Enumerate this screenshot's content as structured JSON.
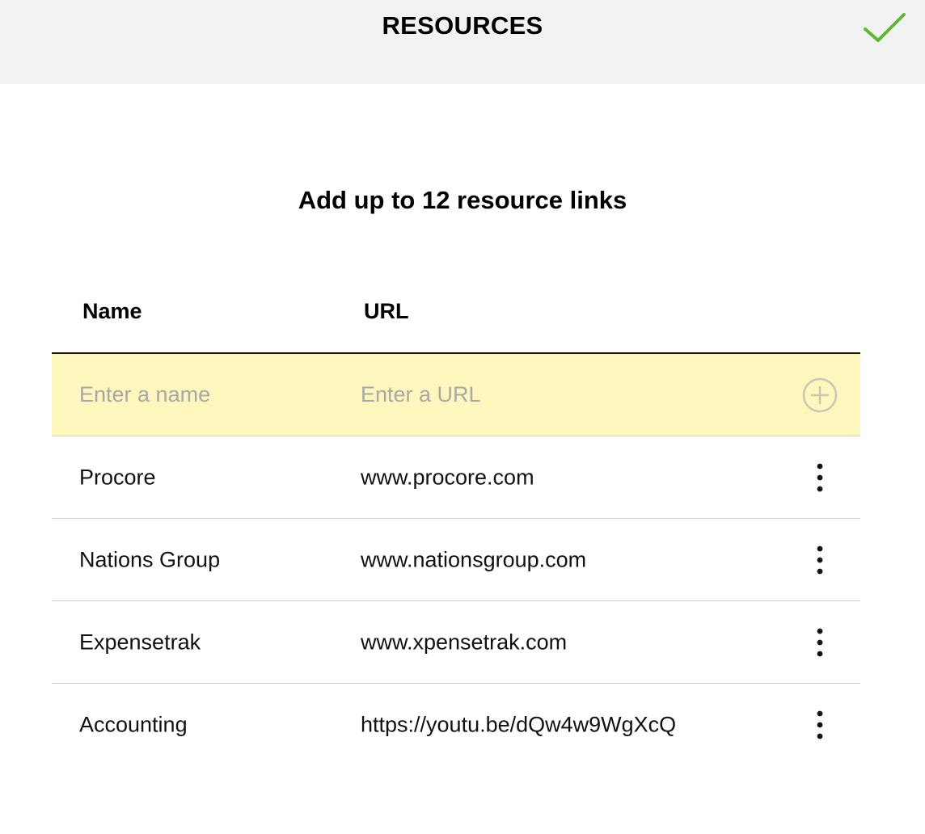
{
  "header": {
    "title": "RESOURCES",
    "confirm_icon": "checkmark-icon",
    "accent_color": "#5cb82e"
  },
  "subtitle": "Add up to 12 resource links",
  "table": {
    "columns": {
      "name": "Name",
      "url": "URL"
    },
    "input_row": {
      "name_placeholder": "Enter a name",
      "url_placeholder": "Enter a URL",
      "name_value": "",
      "url_value": "",
      "add_icon": "plus-circle-icon",
      "highlight_color": "#fdf7bd"
    },
    "rows": [
      {
        "name": "Procore",
        "url": "www.procore.com",
        "menu_icon": "more-vertical-icon"
      },
      {
        "name": "Nations Group",
        "url": "www.nationsgroup.com",
        "menu_icon": "more-vertical-icon"
      },
      {
        "name": "Expensetrak",
        "url": "www.xpensetrak.com",
        "menu_icon": "more-vertical-icon"
      },
      {
        "name": "Accounting",
        "url": "https://youtu.be/dQw4w9WgXcQ",
        "menu_icon": "more-vertical-icon"
      }
    ]
  }
}
